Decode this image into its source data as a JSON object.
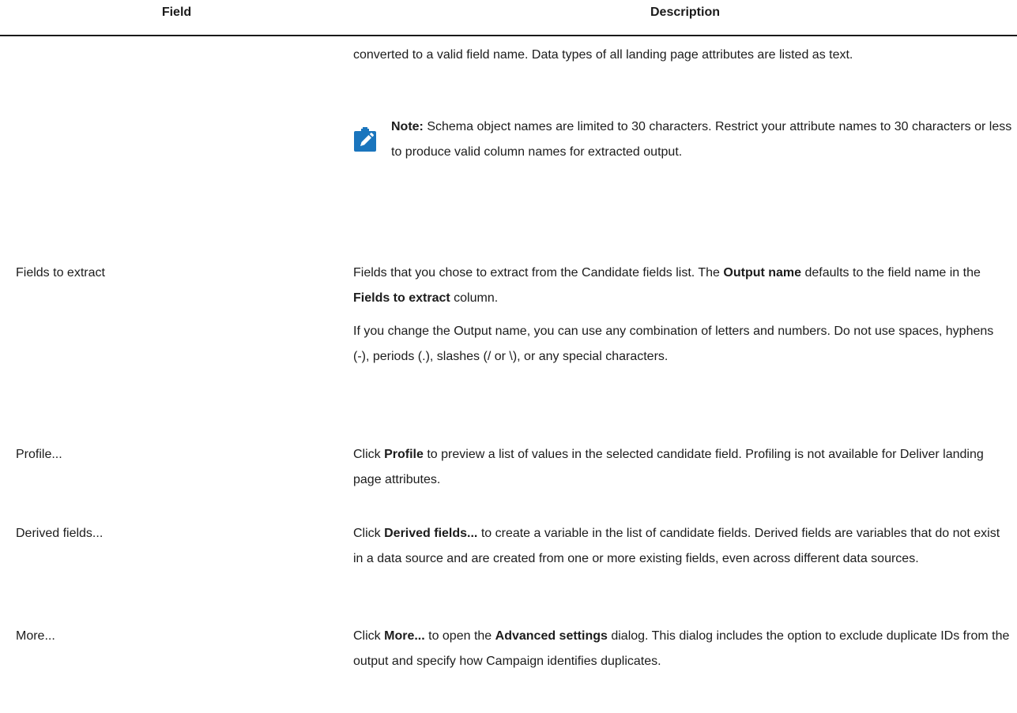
{
  "table": {
    "headers": {
      "field": "Field",
      "description": "Description"
    },
    "intro": {
      "text": "converted to a valid field name. Data types of all landing page attributes are listed as text.",
      "note_label": "Note:",
      "note_text": " Schema object names are limited to 30 characters. Restrict your attribute names to 30 characters or less to produce valid column names for extracted output."
    },
    "rows": [
      {
        "field": "Fields to extract",
        "p1_a": "Fields that you chose to extract from the Candidate fields list. The ",
        "p1_b1": "Output name",
        "p1_c": " defaults to the field name in the ",
        "p1_b2": "Fields to extract",
        "p1_d": " column.",
        "p2": "If you change the Output name, you can use any combination of letters and numbers. Do not use spaces, hyphens (-), periods (.), slashes (/ or \\), or any special characters."
      },
      {
        "field": "Profile...",
        "p1_a": "Click ",
        "p1_b1": "Profile",
        "p1_c": " to preview a list of values in the selected candidate field. Profiling is not available for Deliver landing page attributes."
      },
      {
        "field": "Derived fields...",
        "p1_a": "Click ",
        "p1_b1": "Derived fields...",
        "p1_c": " to create a variable in the list of candidate fields. Derived fields are variables that do not exist in a data source and are created from one or more existing fields, even across different data sources."
      },
      {
        "field": "More...",
        "p1_a": "Click ",
        "p1_b1": "More...",
        "p1_c": " to open the ",
        "p1_b2": "Advanced settings",
        "p1_d": " dialog. This dialog includes the option to exclude duplicate IDs from the output and specify how Campaign identifies duplicates."
      }
    ]
  },
  "colors": {
    "note_icon": "#1a75bd",
    "rule": "#1a1a1a"
  },
  "icons": {
    "note": "pencil-note-icon"
  }
}
